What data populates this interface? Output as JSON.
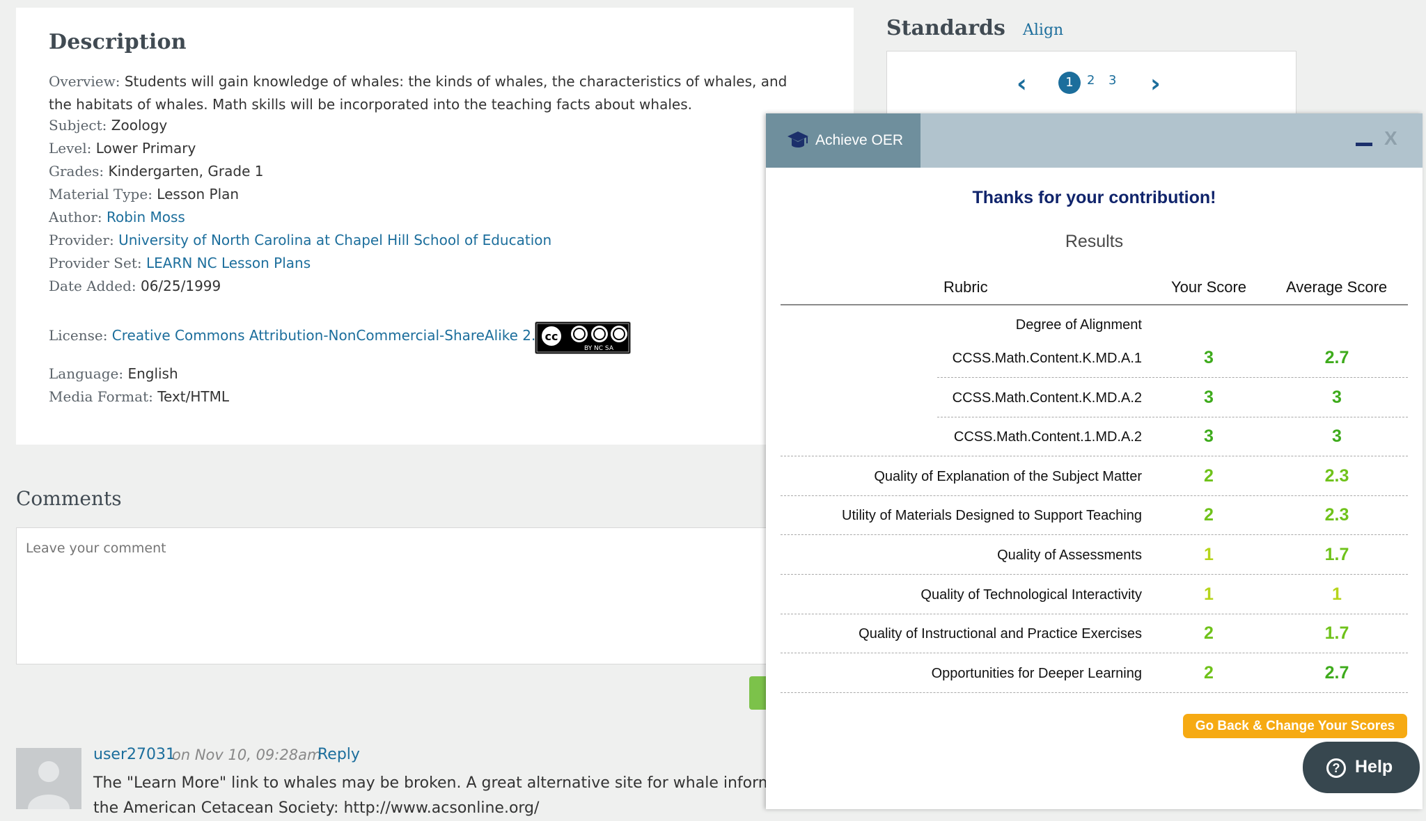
{
  "description": {
    "title": "Description",
    "overview_label": "Overview:",
    "overview_text": " Students will gain knowledge of whales: the kinds of whales, the characteristics of whales, and the habitats of whales. Math skills will be incorporated into the teaching facts about whales.",
    "fields": [
      {
        "label": "Subject:",
        "value": "Zoology"
      },
      {
        "label": "Level:",
        "value": "Lower Primary"
      },
      {
        "label": "Grades:",
        "value": "Kindergarten, Grade 1"
      },
      {
        "label": "Material Type:",
        "value": "Lesson Plan"
      },
      {
        "label": "Author:",
        "value": "Robin Moss"
      },
      {
        "label": "Provider:",
        "value": "University of North Carolina at Chapel Hill School of Education"
      },
      {
        "label": "Provider Set:",
        "value": "LEARN NC Lesson Plans"
      },
      {
        "label": "Date Added:",
        "value": "06/25/1999"
      },
      {
        "label": "License:",
        "value": "Creative Commons Attribution-NonCommercial-ShareAlike 2.5"
      },
      {
        "label": "Language:",
        "value": "English"
      },
      {
        "label": "Media Format:",
        "value": "Text/HTML"
      }
    ],
    "license_badge_text": "BY NC SA"
  },
  "standards": {
    "title": "Standards",
    "align_link": "Align",
    "pagination": {
      "prev_icon": "chevron-left-icon",
      "pages": [
        "1",
        "2",
        "3"
      ],
      "current": "1",
      "next_icon": "chevron-right-icon"
    }
  },
  "comments": {
    "title": "Comments",
    "placeholder": "Leave your comment",
    "items": [
      {
        "user": "user27031",
        "time": "on Nov 10, 09:28am",
        "reply": "Reply",
        "text": "The \"Learn More\" link to whales may be broken. A great alternative site for whale inform",
        "text2": "the American Cetacean Society: http://www.acsonline.org/"
      }
    ]
  },
  "popup": {
    "tab_title": "Achieve OER",
    "tab_icon": "graduation-cap-icon",
    "minimize_icon": "minimize-icon",
    "close_label": "X",
    "thanks": "Thanks for your contribution!",
    "results": "Results",
    "headers": {
      "rubric": "Rubric",
      "your": "Your Score",
      "average": "Average Score"
    },
    "group_title": "Degree of Alignment",
    "rows": [
      {
        "label": "CCSS.Math.Content.K.MD.A.1",
        "your": "3",
        "avg": "2.7",
        "your_color": "#3eab1c",
        "avg_color": "#3eab1c",
        "sub": true
      },
      {
        "label": "CCSS.Math.Content.K.MD.A.2",
        "your": "3",
        "avg": "3",
        "your_color": "#3eab1c",
        "avg_color": "#3eab1c",
        "sub": true
      },
      {
        "label": "CCSS.Math.Content.1.MD.A.2",
        "your": "3",
        "avg": "3",
        "your_color": "#3eab1c",
        "avg_color": "#3eab1c",
        "sub": true
      },
      {
        "label": "Quality of Explanation of the Subject Matter",
        "your": "2",
        "avg": "2.3",
        "your_color": "#6fc21a",
        "avg_color": "#6fc21a",
        "sub": false
      },
      {
        "label": "Utility of Materials Designed to Support Teaching",
        "your": "2",
        "avg": "2.3",
        "your_color": "#6fc21a",
        "avg_color": "#6fc21a",
        "sub": false
      },
      {
        "label": "Quality of Assessments",
        "your": "1",
        "avg": "1.7",
        "your_color": "#b6d41a",
        "avg_color": "#6fc21a",
        "sub": false
      },
      {
        "label": "Quality of Technological Interactivity",
        "your": "1",
        "avg": "1",
        "your_color": "#b6d41a",
        "avg_color": "#b6d41a",
        "sub": false
      },
      {
        "label": "Quality of Instructional and Practice Exercises",
        "your": "2",
        "avg": "1.7",
        "your_color": "#6fc21a",
        "avg_color": "#6fc21a",
        "sub": false
      },
      {
        "label": "Opportunities for Deeper Learning",
        "your": "2",
        "avg": "2.7",
        "your_color": "#6fc21a",
        "avg_color": "#3eab1c",
        "sub": false
      }
    ],
    "go_back_button": "Go Back & Change Your Scores",
    "help_button": "Help",
    "help_icon": "question-circle-icon"
  },
  "colors": {
    "link": "#1c6e9c",
    "page_background": "#eff0ef",
    "popup_header": "#b1c3cd",
    "popup_tab": "#6f8f9d",
    "thanks_text": "#10246b",
    "go_back_button": "#f6aa13",
    "help_button": "#37474f"
  }
}
